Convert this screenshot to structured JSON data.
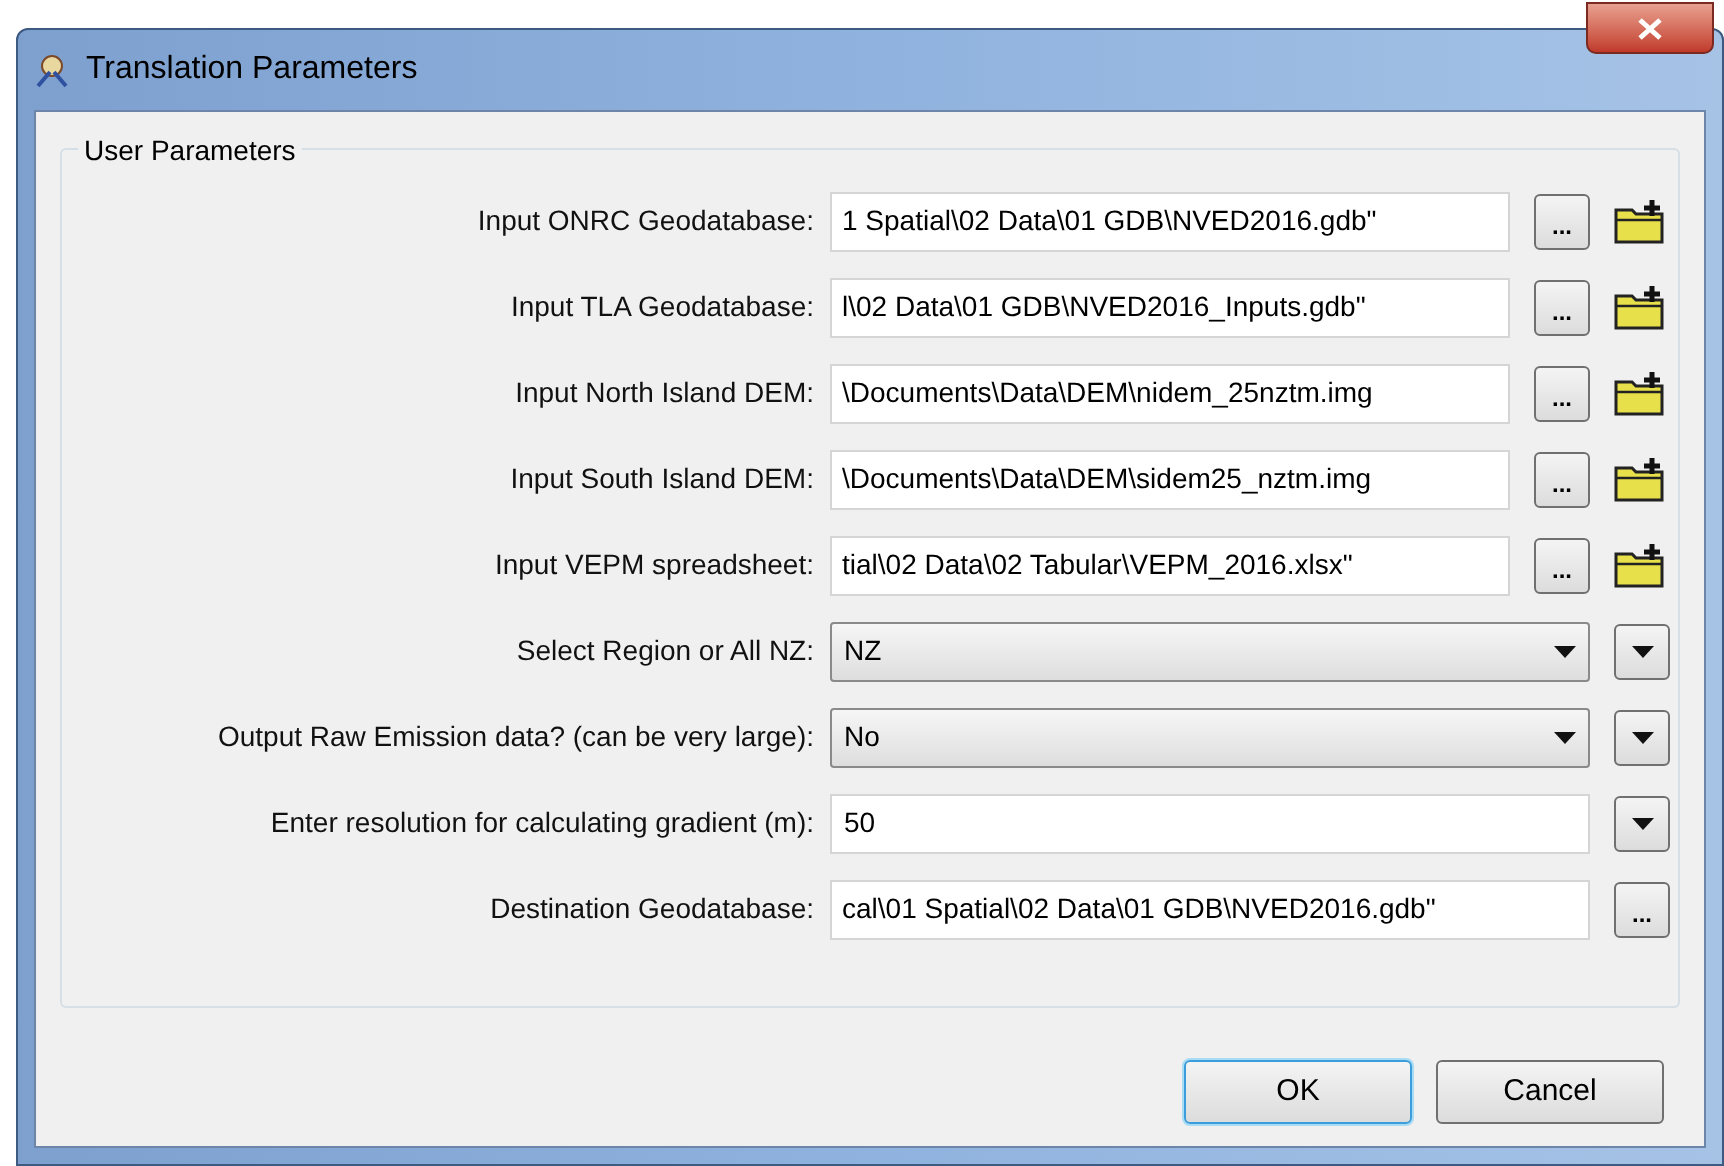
{
  "window": {
    "title": "Translation Parameters"
  },
  "group": {
    "title": "User Parameters"
  },
  "parameters": [
    {
      "label": "Input ONRC Geodatabase:",
      "kind": "file",
      "value": "1 Spatial\\02 Data\\01 GDB\\NVED2016.gdb\"",
      "browse": "..."
    },
    {
      "label": "Input TLA Geodatabase:",
      "kind": "file",
      "value": "l\\02 Data\\01 GDB\\NVED2016_Inputs.gdb\"",
      "browse": "..."
    },
    {
      "label": "Input North Island DEM:",
      "kind": "file",
      "value": "\\Documents\\Data\\DEM\\nidem_25nztm.img",
      "browse": "..."
    },
    {
      "label": "Input South Island DEM:",
      "kind": "file",
      "value": "\\Documents\\Data\\DEM\\sidem25_nztm.img",
      "browse": "..."
    },
    {
      "label": "Input VEPM spreadsheet:",
      "kind": "file",
      "value": "tial\\02 Data\\02 Tabular\\VEPM_2016.xlsx\"",
      "browse": "..."
    },
    {
      "label": "Select Region or All NZ:",
      "kind": "choice",
      "value": "NZ"
    },
    {
      "label": "Output Raw Emission data? (can be very large):",
      "kind": "choice",
      "value": "No"
    },
    {
      "label": "Enter resolution for calculating gradient (m):",
      "kind": "text",
      "value": "50"
    },
    {
      "label": "Destination Geodatabase:",
      "kind": "output",
      "value": "cal\\01 Spatial\\02 Data\\01 GDB\\NVED2016.gdb\"",
      "browse": "..."
    }
  ],
  "buttons": [
    {
      "label": "OK",
      "default": true
    },
    {
      "label": "Cancel",
      "default": false
    }
  ]
}
